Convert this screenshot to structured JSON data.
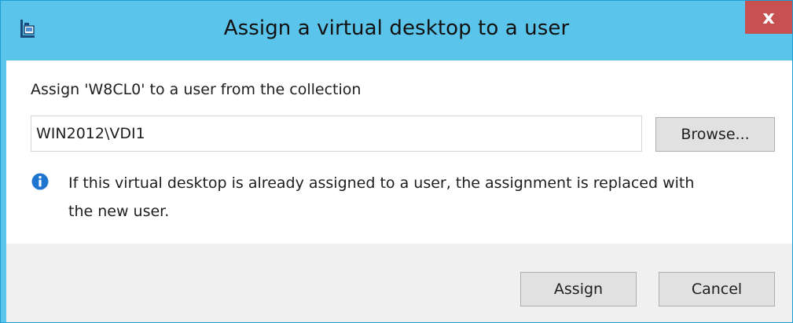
{
  "window": {
    "title": "Assign a virtual desktop to a user",
    "close_label": "x"
  },
  "dialog": {
    "prompt": "Assign 'W8CL0' to a user from the collection",
    "user_field_value": "WIN2012\\VDI1",
    "browse_label": "Browse...",
    "info_line_1": "If this virtual desktop is already assigned to a user, the assignment is replaced with",
    "info_line_2": "the new user."
  },
  "footer": {
    "assign_label": "Assign",
    "cancel_label": "Cancel"
  },
  "icons": {
    "app": "remote-desktop-app-icon",
    "info": "info-icon",
    "close": "close-icon"
  },
  "colors": {
    "titlebar": "#5bc4ea",
    "close_button": "#c75050",
    "info_icon": "#1f76d1",
    "footer": "#f0f0f0",
    "button": "#e1e1e1"
  }
}
